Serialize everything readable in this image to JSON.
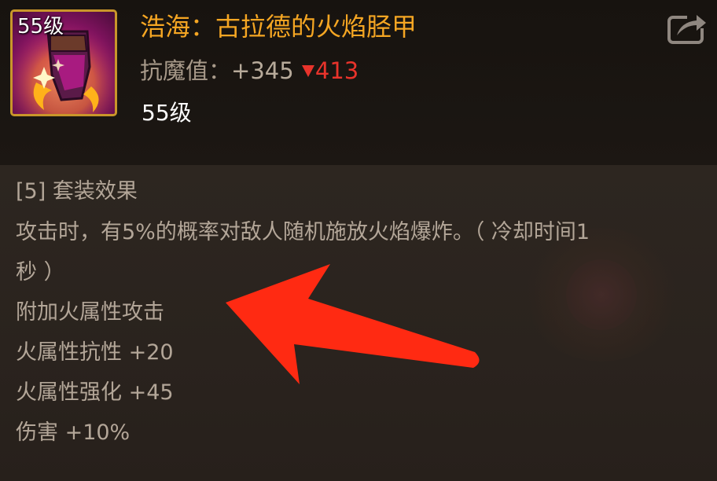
{
  "item": {
    "level_badge": "55级",
    "name": "浩海：古拉德的火焰胫甲",
    "stat_label": "抗魔值：",
    "stat_value": "+345",
    "stat_diff_icon": "down-triangle-icon",
    "stat_diff": "413",
    "level_text": "55级"
  },
  "set_effect": {
    "lines": [
      "[5] 套装效果",
      "攻击时，有5%的概率对敌人随机施放火焰爆炸。（ 冷却时间1",
      "秒 ）",
      "附加火属性攻击",
      "火属性抗性 +20",
      "火属性强化 +45",
      "伤害 +10%"
    ]
  },
  "colors": {
    "item_name": "#f5a623",
    "stat_down": "#e8332b",
    "annotation_arrow": "#ff2a12",
    "icon_border": "#c9962a"
  },
  "icons": [
    "share-icon",
    "down-triangle-icon",
    "annotation-arrow"
  ]
}
